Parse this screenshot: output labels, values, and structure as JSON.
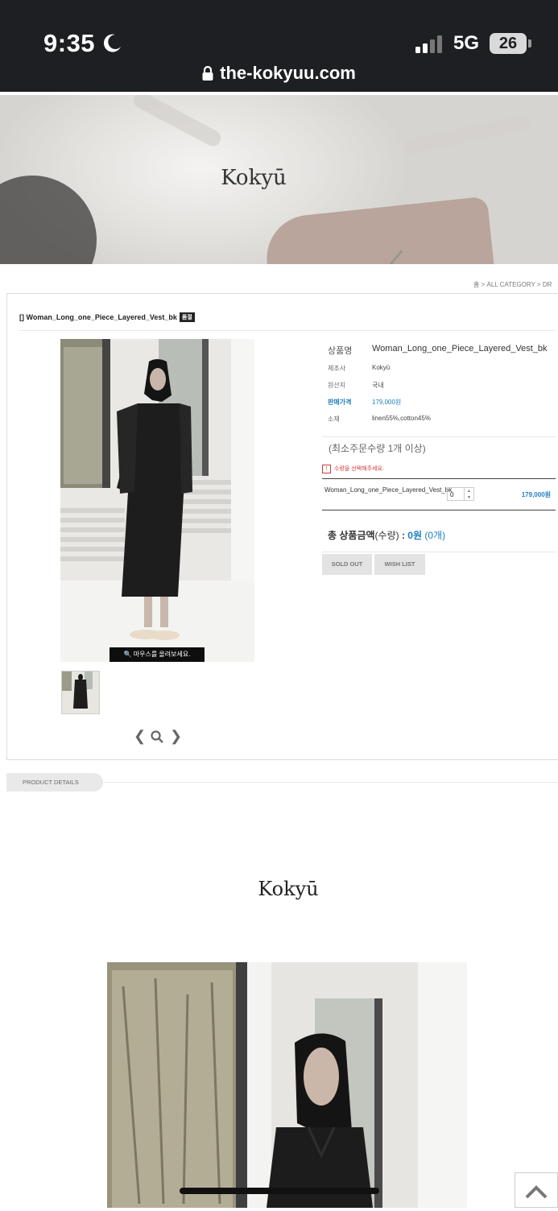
{
  "status_bar": {
    "time": "9:35",
    "network": "5G",
    "battery": "26"
  },
  "browser": {
    "url": "the-kokyuu.com"
  },
  "hero": {
    "brand": "Kokyū"
  },
  "breadcrumb": {
    "home": "홈",
    "sep": ">",
    "category": "ALL CATEGORY",
    "sub": "DR"
  },
  "product": {
    "title": "[] Woman_Long_one_Piece_Layered_Vest_bk",
    "badge": "품절",
    "zoom_hint": "마우스를 올려보세요.",
    "info": [
      {
        "label": "상품명",
        "value": "Woman_Long_one_Piece_Layered_Vest_bk"
      },
      {
        "label": "제조사",
        "value": "Kokyū"
      },
      {
        "label": "원산지",
        "value": "국내"
      },
      {
        "label": "판매가격",
        "value": "179,000원"
      },
      {
        "label": "소재",
        "value": "linen55%,cotton45%"
      }
    ],
    "min_qty": "(최소주문수량 1개 이상)",
    "warning_icon": "!",
    "warning": "수량을 선택해주세요.",
    "option": {
      "name": "Woman_Long_one_Piece_Layered_Vest_bk",
      "qty": "0",
      "price": "179,000원"
    },
    "total": {
      "label": "총 상품금액",
      "qty_label": "(수량)",
      "colon": " : ",
      "amount": "0원",
      "count": "(0개)"
    },
    "buttons": {
      "sold_out": "SOLD OUT",
      "wish_list": "WISH LIST"
    }
  },
  "details": {
    "tab": "PRODUCT DETAILS",
    "brand": "Kokyū"
  },
  "colors": {
    "status_bg": "#1d1f23",
    "accent_blue": "#1e7fc0",
    "warn_red": "#d03b3b"
  }
}
